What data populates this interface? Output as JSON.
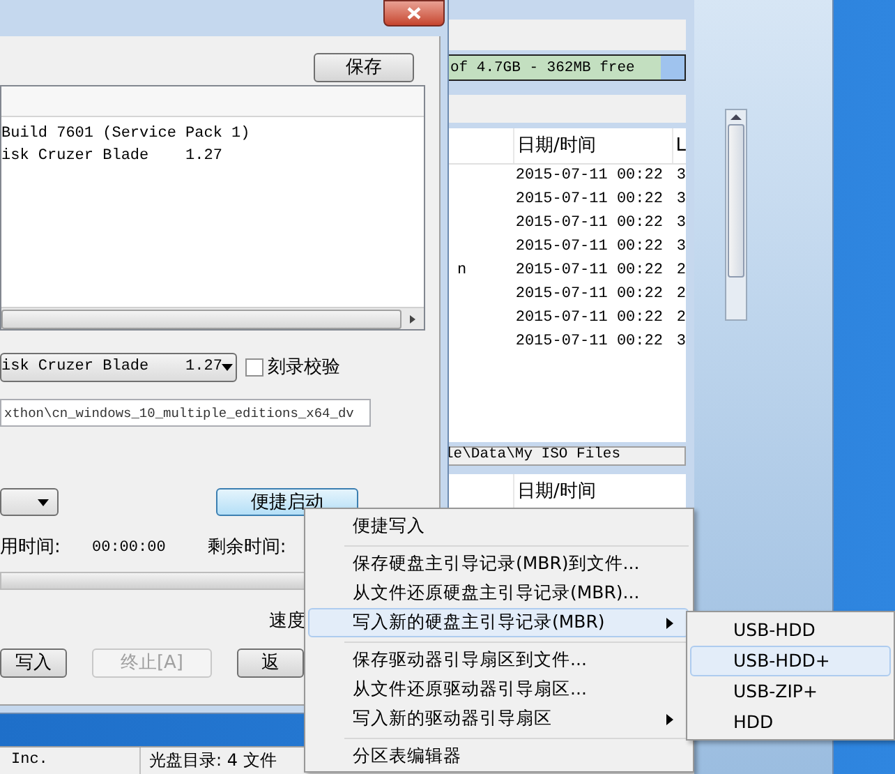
{
  "dialog": {
    "save_button": "保存",
    "info_lines": [
      "Build 7601 (Service Pack 1)",
      "isk Cruzer Blade    1.27"
    ],
    "device_select": {
      "value": "isk Cruzer Blade    1.27"
    },
    "verify_checkbox": {
      "label": "刻录校验",
      "checked": false
    },
    "image_path": {
      "value": "xthon\\cn_windows_10_multiple_editions_x64_dv"
    },
    "quick_boot_button": "便捷启动",
    "elapsed": {
      "label": "用时间:",
      "value": "00:00:00"
    },
    "remaining": {
      "label": "剩余时间:"
    },
    "progress": {
      "level": 0
    },
    "speed_label": "速度",
    "buttons": [
      {
        "label": "写入",
        "disabled": false
      },
      {
        "label": "终止[A]",
        "disabled": true
      },
      {
        "label": "返",
        "disabled": false
      }
    ]
  },
  "main_window": {
    "capacity": {
      "text": "of 4.7GB - 362MB free",
      "level": 0.9
    },
    "file_list": {
      "columns": [
        "日期/时间",
        "L"
      ],
      "rows": [
        {
          "date": "2015-07-11 00:22",
          "column_3": "3"
        },
        {
          "date": "2015-07-11 00:22",
          "column_3": "3"
        },
        {
          "date": "2015-07-11 00:22",
          "column_3": "3"
        },
        {
          "date": "2015-07-11 00:22",
          "column_3": "3"
        },
        {
          "column_1": "n",
          "date": "2015-07-11 00:22",
          "column_3": "2"
        },
        {
          "date": "2015-07-11 00:22",
          "column_3": "2"
        },
        {
          "date": "2015-07-11 00:22",
          "column_3": "2"
        },
        {
          "date": "2015-07-11 00:22",
          "column_3": "3"
        }
      ]
    },
    "path": "le\\Data\\My ISO Files",
    "lower_list": {
      "columns": [
        "日期/时间"
      ]
    },
    "status_bar": [
      "Inc.",
      "光盘目录: 4 文件"
    ]
  },
  "context_menu": {
    "items": [
      {
        "kind": "item",
        "label": "便捷写入",
        "submenu": false,
        "selected": false
      },
      {
        "kind": "separator"
      },
      {
        "kind": "item",
        "label": "保存硬盘主引导记录(MBR)到文件...",
        "submenu": false,
        "selected": false
      },
      {
        "kind": "item",
        "label": "从文件还原硬盘主引导记录(MBR)...",
        "submenu": false,
        "selected": false
      },
      {
        "kind": "item",
        "label": "写入新的硬盘主引导记录(MBR)",
        "submenu": true,
        "selected": true
      },
      {
        "kind": "separator"
      },
      {
        "kind": "item",
        "label": "保存驱动器引导扇区到文件...",
        "submenu": false,
        "selected": false
      },
      {
        "kind": "item",
        "label": "从文件还原驱动器引导扇区...",
        "submenu": false,
        "selected": false
      },
      {
        "kind": "item",
        "label": "写入新的驱动器引导扇区",
        "submenu": true,
        "selected": false
      },
      {
        "kind": "separator"
      },
      {
        "kind": "item",
        "label": "分区表编辑器",
        "submenu": false,
        "selected": false
      }
    ]
  },
  "submenu": {
    "items": [
      {
        "label": "USB-HDD",
        "selected": false
      },
      {
        "label": "USB-HDD+",
        "selected": true
      },
      {
        "label": "USB-ZIP+",
        "selected": false
      },
      {
        "label": "HDD",
        "selected": false
      }
    ]
  }
}
